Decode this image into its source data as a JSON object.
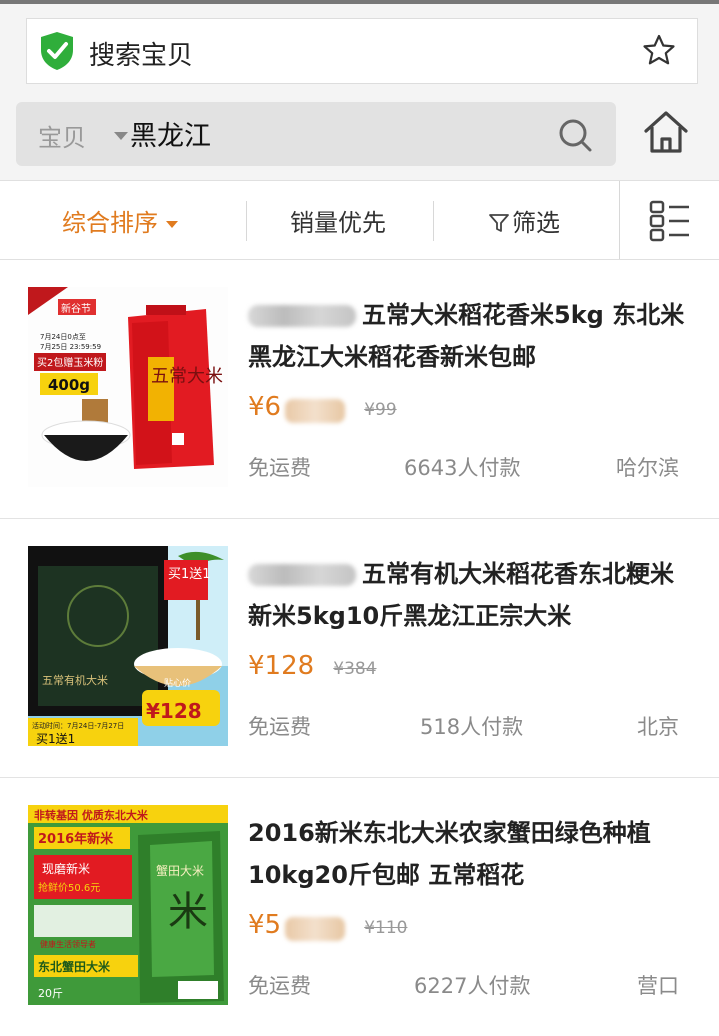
{
  "browser": {
    "address_title": "搜索宝贝"
  },
  "search": {
    "scope": "宝贝",
    "query": "黑龙江"
  },
  "sort": {
    "comprehensive": "综合排序",
    "sales": "销量优先",
    "filter": "筛选"
  },
  "products": [
    {
      "title": "五常大米稻花香米5kg 东北米黑龙江大米稻花香新米包邮",
      "price": "¥6",
      "original_price": "¥99",
      "shipping": "免运费",
      "sold": "6643人付款",
      "location": "哈尔滨",
      "image_texts": [
        "新谷节",
        "7月24日0点至",
        "7月25日 23:59:59",
        "买2包赠玉米粉",
        "400g",
        "五常大米"
      ]
    },
    {
      "title": "五常有机大米稻花香东北粳米新米5kg10斤黑龙江正宗大米",
      "price": "¥128",
      "original_price": "¥384",
      "shipping": "免运费",
      "sold": "518人付款",
      "location": "北京",
      "image_texts": [
        "买1送1",
        "贴心价",
        "¥128",
        "活动时间：7月24日-7月27日",
        "买1送1",
        "五常有机大米"
      ]
    },
    {
      "title": "2016新米东北大米农家蟹田绿色种植10kg20斤包邮 五常稻花",
      "price": "¥5",
      "original_price": "¥110",
      "shipping": "免运费",
      "sold": "6227人付款",
      "location": "营口",
      "image_texts": [
        "非转基因 优质东北大米",
        "2016年新米",
        "现磨新米",
        "抢鲜价50.6元",
        "健康生活领导者",
        "东北蟹田大米",
        "20斤",
        "蟹田大米"
      ]
    }
  ]
}
